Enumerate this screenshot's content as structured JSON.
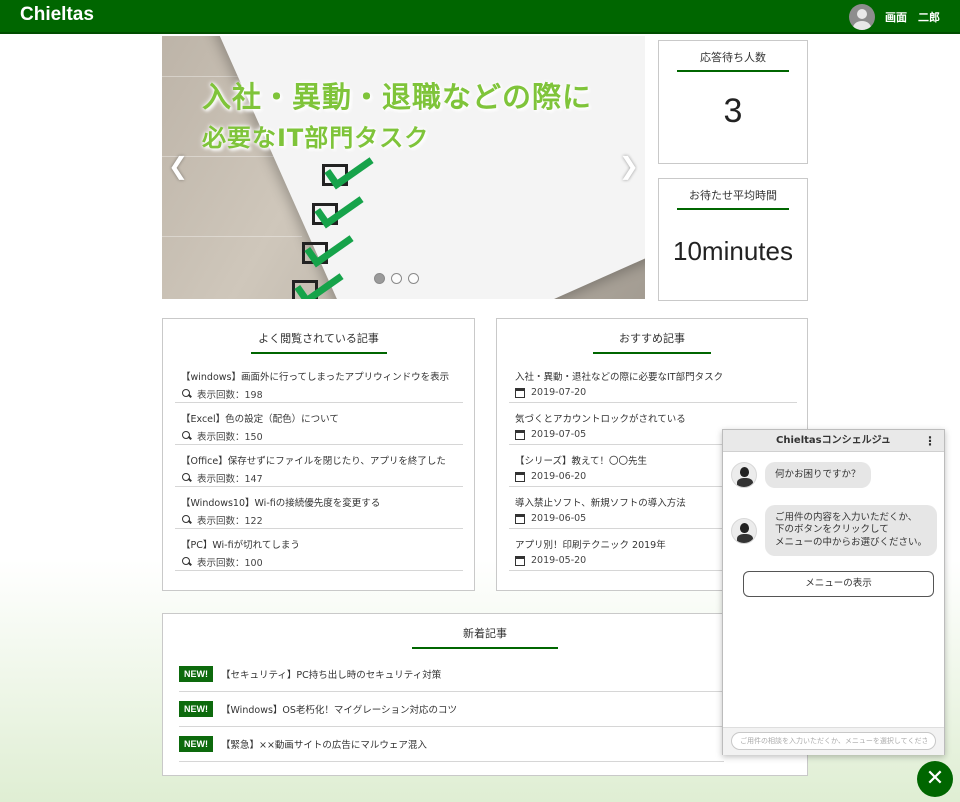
{
  "header": {
    "brand": "Chieltas",
    "user_name": "画面　二郎"
  },
  "carousel": {
    "title_line1": "入社・異動・退職などの際に",
    "title_line2": "必要なIT部門タスク",
    "prev_icon": "chevron-left-icon",
    "next_icon": "chevron-right-icon",
    "slide_count": 3,
    "active_slide": 1
  },
  "stats": {
    "waiting": {
      "title": "応答待ち人数",
      "value": "3"
    },
    "avg_wait": {
      "title": "お待たせ平均時間",
      "value": "10minutes"
    }
  },
  "popular": {
    "title": "よく閲覧されている記事",
    "items": [
      {
        "title": "【windows】画面外に行ってしまったアプリウィンドウを表示",
        "meta": "表示回数：198"
      },
      {
        "title": "【Excel】色の設定（配色）について",
        "meta": "表示回数：150"
      },
      {
        "title": "【Office】保存せずにファイルを閉じたり、アプリを終了した",
        "meta": "表示回数：147"
      },
      {
        "title": "【Windows10】Wi-fiの接続優先度を変更する",
        "meta": "表示回数：122"
      },
      {
        "title": "【PC】Wi-fiが切れてしまう",
        "meta": "表示回数：100"
      }
    ]
  },
  "recommend": {
    "title": "おすすめ記事",
    "items": [
      {
        "title": "入社・異動・退社などの際に必要なIT部門タスク",
        "date": "2019-07-20"
      },
      {
        "title": "気づくとアカウントロックがされている",
        "date": "2019-07-05"
      },
      {
        "title": "【シリーズ】教えて！〇〇先生",
        "date": "2019-06-20"
      },
      {
        "title": "導入禁止ソフト、新規ソフトの導入方法",
        "date": "2019-06-05"
      },
      {
        "title": "アプリ別！印刷テクニック 2019年",
        "date": "2019-05-20"
      }
    ]
  },
  "news": {
    "title": "新着記事",
    "badge": "NEW!",
    "items": [
      {
        "text": "【セキュリティ】PC持ち出し時のセキュリティ対策"
      },
      {
        "text": "【Windows】OS老朽化！マイグレーション対応のコツ"
      },
      {
        "text": "【緊急】××動画サイトの広告にマルウェア混入"
      }
    ]
  },
  "chat": {
    "title": "Chieltasコンシェルジュ",
    "menu_icon": "more-vertical-icon",
    "msg1": "何かお困りですか？",
    "msg2_line1": "ご用件の内容を入力いただくか、",
    "msg2_line2": "下のボタンをクリックして",
    "msg2_line3": "メニューの中からお選びください。",
    "menu_button": "メニューの表示",
    "input_placeholder": "ご用件の相談を入力いただくか、メニューを選択してください"
  },
  "close_icon": "close-icon",
  "colors": {
    "brand": "#006600",
    "badge": "#0d6a0d",
    "check": "#16a34a",
    "title_green": "#7fc43a"
  }
}
